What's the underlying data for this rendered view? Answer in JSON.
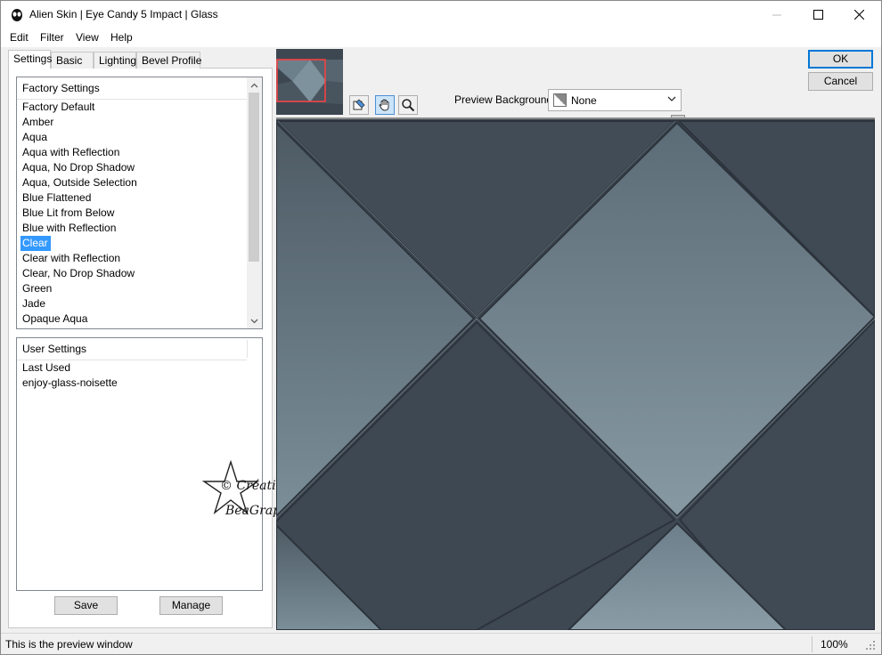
{
  "window": {
    "title": "Alien Skin | Eye Candy 5 Impact | Glass"
  },
  "menu": {
    "items": [
      "Edit",
      "Filter",
      "View",
      "Help"
    ]
  },
  "tabs": [
    {
      "label": "Settings",
      "active": true
    },
    {
      "label": "Basic",
      "active": false
    },
    {
      "label": "Lighting",
      "active": false
    },
    {
      "label": "Bevel Profile",
      "active": false
    }
  ],
  "factory": {
    "header": "Factory Settings",
    "items": [
      "Factory Default",
      "Amber",
      "Aqua",
      "Aqua with Reflection",
      "Aqua, No Drop Shadow",
      "Aqua, Outside Selection",
      "Blue Flattened",
      "Blue Lit from Below",
      "Blue with Reflection",
      "Clear",
      "Clear with Reflection",
      "Clear, No Drop Shadow",
      "Green",
      "Jade",
      "Opaque Aqua"
    ],
    "selected_index": 9
  },
  "user": {
    "header": "User Settings",
    "items": [
      "Last Used",
      "enjoy-glass-noisette"
    ]
  },
  "buttons": {
    "save": "Save",
    "manage": "Manage",
    "ok": "OK",
    "cancel": "Cancel"
  },
  "preview_bg": {
    "label": "Preview Background:",
    "value": "None"
  },
  "watermark": {
    "line1": "© Créations",
    "line2": "BeaGraph"
  },
  "status": {
    "text": "This is the preview window",
    "zoom": "100%"
  },
  "colors": {
    "accent": "#0078d7",
    "selection": "#3399ff",
    "tile_dark": "#3d4752",
    "tile_light": "#7d929d"
  }
}
